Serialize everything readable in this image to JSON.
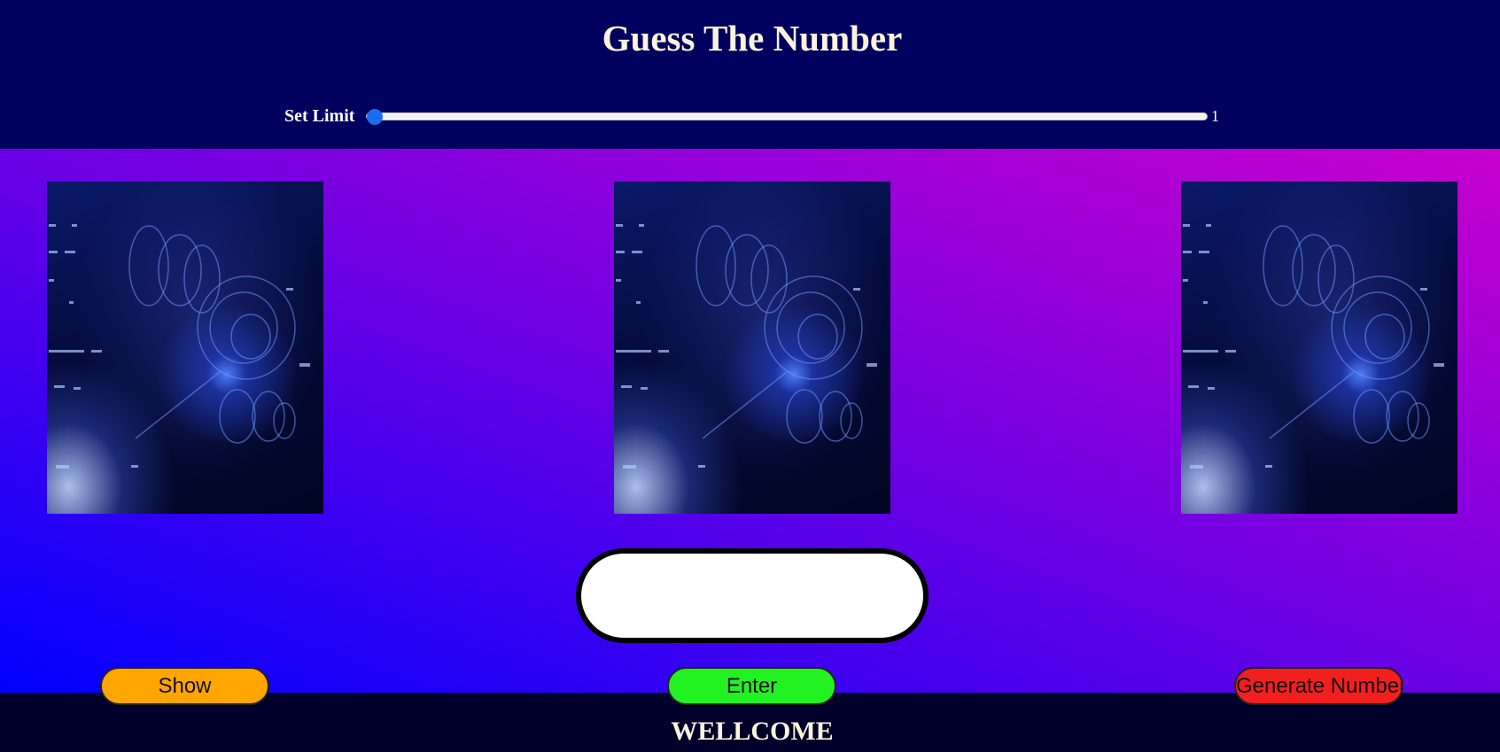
{
  "header": {
    "title": "Guess The Number",
    "limit_label": "Set Limit",
    "limit_value": "1",
    "slider_value": "1"
  },
  "cards": [
    {
      "image": "abstract-blue-tech-image"
    },
    {
      "image": "abstract-blue-tech-image"
    },
    {
      "image": "abstract-blue-tech-image"
    }
  ],
  "input": {
    "value": "",
    "placeholder": ""
  },
  "buttons": {
    "show": "Show",
    "enter": "Enter",
    "generate": "Generate Number"
  },
  "colors": {
    "header_bg": "#00005f",
    "footer_bg": "#00002a",
    "show_button": "#ffa500",
    "enter_button": "#22f222",
    "generate_button": "#f21f1f",
    "title_text": "#fbf3dc"
  },
  "footer": {
    "message": "WELLCOME"
  }
}
